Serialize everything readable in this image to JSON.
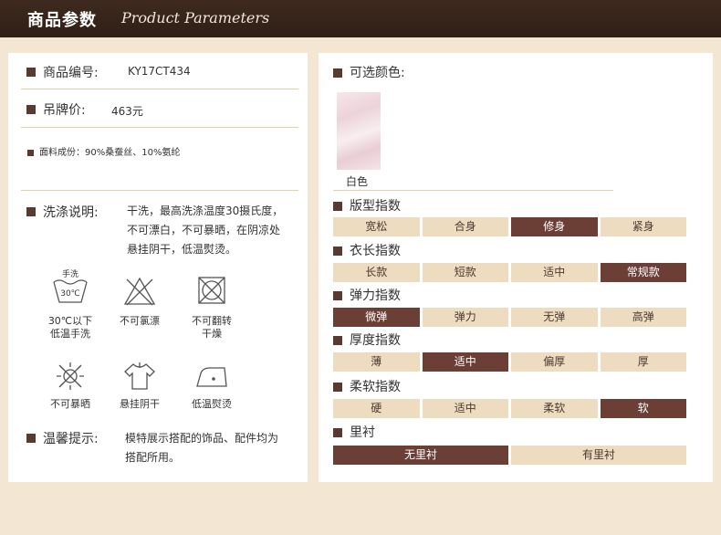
{
  "header": {
    "title_cn": "商品参数",
    "title_en": "Product Parameters"
  },
  "left": {
    "item_no": {
      "label": "商品编号:",
      "value": "KY17CT434"
    },
    "price": {
      "label": "吊牌价:",
      "value": "463元"
    },
    "material": "面料成份：90%桑蚕丝、10%氨纶",
    "wash": {
      "label": "洗涤说明:",
      "lines": [
        "干洗，最高洗涤温度30摄氏度，",
        "不可漂白，不可暴晒，在阴凉处",
        "悬挂阴干，低温熨烫。"
      ]
    },
    "care_icons": [
      {
        "icon": "hand-wash-30-icon",
        "line1": "30℃以下",
        "line2": "低温手洗",
        "inner_top": "手洗",
        "inner_temp": "30℃"
      },
      {
        "icon": "no-bleach-icon",
        "line1": "不可氯漂",
        "line2": ""
      },
      {
        "icon": "no-tumble-dry-icon",
        "line1": "不可翻转",
        "line2": "干燥"
      },
      {
        "icon": "no-sun-icon",
        "line1": "不可暴晒",
        "line2": ""
      },
      {
        "icon": "hang-dry-icon",
        "line1": "悬挂阴干",
        "line2": ""
      },
      {
        "icon": "low-iron-icon",
        "line1": "低温熨烫",
        "line2": ""
      }
    ],
    "tips": {
      "label": "温馨提示:",
      "lines": [
        "模特展示搭配的饰品、配件均为",
        "搭配所用。"
      ]
    }
  },
  "right": {
    "colors": {
      "label": "可选颜色:",
      "items": [
        {
          "name": "白色",
          "color": "#f1dde2"
        }
      ]
    },
    "fit": {
      "label": "版型指数",
      "options": [
        "宽松",
        "合身",
        "修身",
        "紧身"
      ],
      "selected": 2
    },
    "length": {
      "label": "衣长指数",
      "options": [
        "长款",
        "短款",
        "适中",
        "常规款"
      ],
      "selected": 3
    },
    "elastic": {
      "label": "弹力指数",
      "options": [
        "微弹",
        "弹力",
        "无弹",
        "高弹"
      ],
      "selected": 0
    },
    "thickness": {
      "label": "厚度指数",
      "options": [
        "薄",
        "适中",
        "偏厚",
        "厚"
      ],
      "selected": 1
    },
    "softness": {
      "label": "柔软指数",
      "options": [
        "硬",
        "适中",
        "柔软",
        "软"
      ],
      "selected": 3
    },
    "lining": {
      "label": "里衬",
      "options": [
        "无里衬",
        "有里衬"
      ],
      "selected": 0
    }
  },
  "colors": {
    "header_bg": "#3e2a1f",
    "page_bg": "#f3e6d2",
    "accent": "#6b3f36",
    "cell_bg": "#eedcc0",
    "bullet": "#5a3a2e"
  }
}
